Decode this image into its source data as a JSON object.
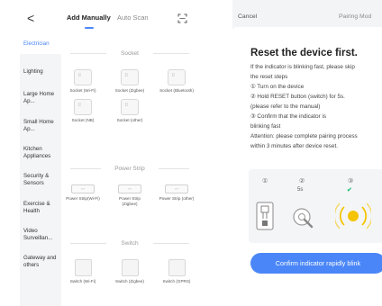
{
  "left": {
    "back_glyph": "<",
    "tabs": [
      "Add Manually",
      "Auto Scan"
    ],
    "icons": {
      "scan": "scan-icon"
    },
    "sidebar": [
      {
        "label": "Electrician",
        "active": true
      },
      {
        "label": "Lighting"
      },
      {
        "label": "Large Home Ap..."
      },
      {
        "label": "Small Home Ap..."
      },
      {
        "label": "Kitchen Appliances"
      },
      {
        "label": "Security & Sensors"
      },
      {
        "label": "Exercise & Health"
      },
      {
        "label": "Video Surveillan..."
      },
      {
        "label": "Gateway and others"
      }
    ],
    "sections": {
      "socket": "Socket",
      "power_strip": "Power Strip",
      "switch": "Switch"
    },
    "socket_devices": [
      {
        "label": "Socket (Wi-Fi)"
      },
      {
        "label": "Socket (Zigbee)"
      },
      {
        "label": "Socket (Bluetooth)"
      },
      {
        "label": "Socket (NB)"
      },
      {
        "label": "Socket (other)"
      }
    ],
    "strip_devices": [
      {
        "label": "Power Strip(Wi-Fi)"
      },
      {
        "label": "Power Strip (Zigbee)"
      },
      {
        "label": "Power Strip (other)"
      }
    ],
    "switch_devices": [
      {
        "label": "Switch (Wi-Fi)"
      },
      {
        "label": "Switch (Zigbee)"
      },
      {
        "label": "Switch (GPRS)"
      }
    ],
    "accent_color": "#4a86f7"
  },
  "right": {
    "cancel": "Cancel",
    "mode": "Pairing Mod",
    "title": "Reset the device first.",
    "lines": [
      "If the indicator is blinking fast, please skip",
      "the reset steps",
      "① Turn on the device",
      "② Hold RESET button (switch) for 5s.",
      "(please refer to the manual)",
      "③ Confirm that the indicator is",
      "blinking fast",
      "Attention: please complete pairing process",
      "within 3 minutes after device reset."
    ],
    "steps": [
      "①",
      "②",
      "③"
    ],
    "step2_caption": "5s",
    "step3_mark": "✔",
    "confirm_button": "Confirm indicator rapidly blink",
    "button_color": "#4a86f7",
    "check_color": "#2ec27e",
    "blink_color": "#f5c400"
  }
}
